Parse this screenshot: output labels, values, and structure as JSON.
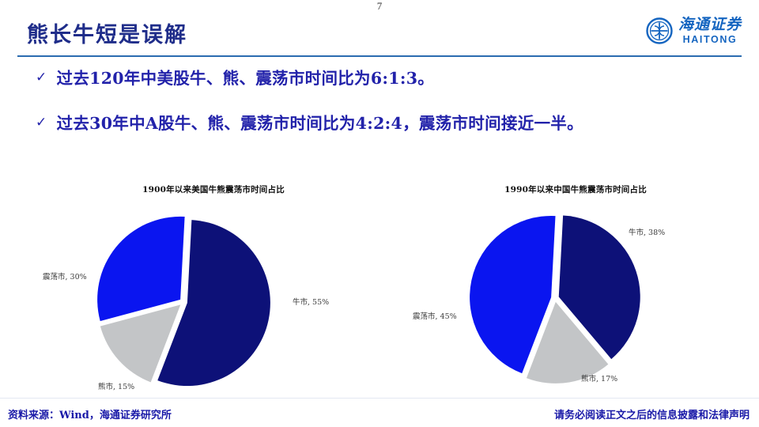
{
  "slide": {
    "title": "熊长牛短是误解",
    "page_number": "7"
  },
  "brand": {
    "name_cn": "海通证券",
    "name_en": "HAITONG",
    "color": "#1565c0"
  },
  "bullets": [
    {
      "marker": "✓",
      "text": "过去120年中美股牛、熊、震荡市时间比为6:1:3。"
    },
    {
      "marker": "✓",
      "text": "过去30年中A股牛、熊、震荡市时间比为4:2:4，震荡市时间接近一半。"
    }
  ],
  "footer": {
    "source": "资料来源：Wind，海通证券研究所",
    "disclaimer": "请务必阅读正文之后的信息披露和法律声明"
  },
  "colors": {
    "bull": "#0d1178",
    "bear": "#c3c5c7",
    "range": "#0a15f0",
    "title_blue": "#1f2d8a",
    "rule_blue": "#2b6cb0",
    "text_blue": "#2222aa"
  },
  "chart_data": [
    {
      "id": "us",
      "type": "pie",
      "title": "1900年以来美国牛熊震荡市时间占比",
      "categories": [
        "牛市",
        "熊市",
        "震荡市"
      ],
      "values": [
        55,
        15,
        30
      ],
      "unit": "%",
      "labels": [
        "牛市, 55%",
        "熊市, 15%",
        "震荡市, 30%"
      ],
      "colors": [
        "#0d1178",
        "#c3c5c7",
        "#0a15f0"
      ],
      "exploded": true,
      "legend": "none"
    },
    {
      "id": "cn",
      "type": "pie",
      "title": "1990年以来中国牛熊震荡市时间占比",
      "categories": [
        "牛市",
        "熊市",
        "震荡市"
      ],
      "values": [
        38,
        17,
        45
      ],
      "unit": "%",
      "labels": [
        "牛市, 38%",
        "熊市, 17%",
        "震荡市, 45%"
      ],
      "colors": [
        "#0d1178",
        "#c3c5c7",
        "#0a15f0"
      ],
      "exploded": true,
      "legend": "none"
    }
  ]
}
